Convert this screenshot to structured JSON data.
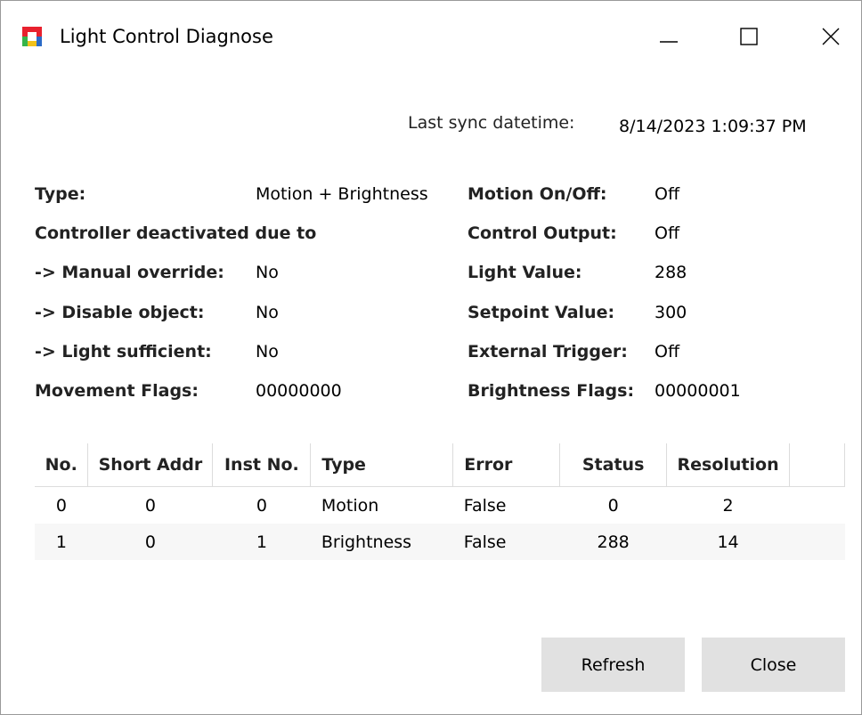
{
  "window": {
    "title": "Light Control Diagnose",
    "icon": "app-color-squares-icon",
    "controls": {
      "minimize_icon": "minimize-icon",
      "maximize_icon": "maximize-icon",
      "close_icon": "close-icon"
    }
  },
  "sync": {
    "label": "Last sync datetime:",
    "value": "8/14/2023 1:09:37 PM"
  },
  "left_info": {
    "type_label": "Type:",
    "type_value": "Motion + Brightness",
    "deactivated_label": "Controller deactivated due to",
    "manual_override_label": "-> Manual override:",
    "manual_override_value": "No",
    "disable_object_label": "-> Disable object:",
    "disable_object_value": "No",
    "light_sufficient_label": "-> Light sufficient:",
    "light_sufficient_value": "No",
    "movement_flags_label": "Movement Flags:",
    "movement_flags_value": "00000000"
  },
  "right_info": {
    "motion_label": "Motion On/Off:",
    "motion_value": "Off",
    "control_output_label": "Control Output:",
    "control_output_value": "Off",
    "light_value_label": "Light Value:",
    "light_value_value": "288",
    "setpoint_label": "Setpoint Value:",
    "setpoint_value": "300",
    "external_trigger_label": "External Trigger:",
    "external_trigger_value": "Off",
    "brightness_flags_label": "Brightness Flags:",
    "brightness_flags_value": "00000001"
  },
  "table": {
    "headers": [
      "No.",
      "Short Addr",
      "Inst No.",
      "Type",
      "Error",
      "Status",
      "Resolution"
    ],
    "rows": [
      [
        "0",
        "0",
        "0",
        "Motion",
        "False",
        "0",
        "2"
      ],
      [
        "1",
        "0",
        "1",
        "Brightness",
        "False",
        "288",
        "14"
      ]
    ]
  },
  "buttons": {
    "refresh": "Refresh",
    "close": "Close"
  },
  "colors": {
    "button_bg": "#e1e1e1",
    "icon_red": "#e8212e",
    "icon_green": "#36b44a",
    "icon_blue": "#2b6bc7",
    "icon_yellow": "#f2c21b"
  }
}
